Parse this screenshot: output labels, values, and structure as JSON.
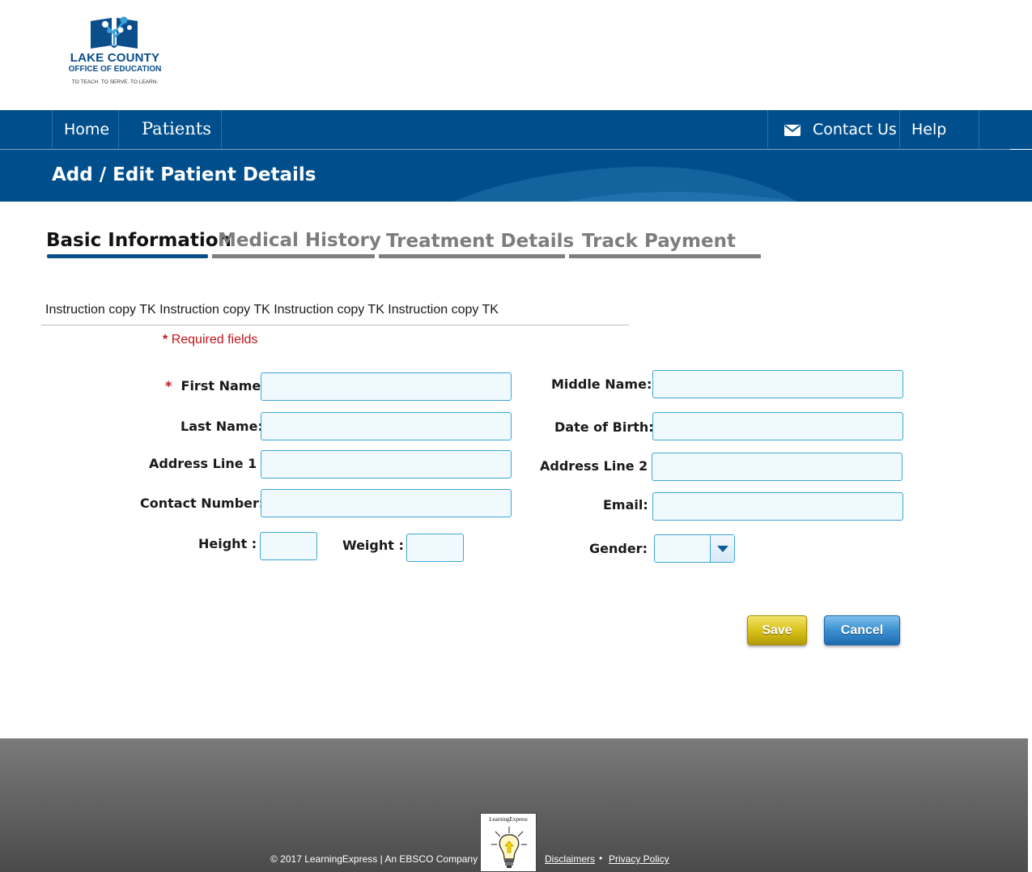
{
  "logo": {
    "line1": "LAKE COUNTY",
    "line2": "OFFICE OF EDUCATION",
    "tagline": "TO TEACH. TO SERVE. TO LEARN."
  },
  "nav": {
    "home": "Home",
    "patients": "Patients",
    "contact": "Contact Us",
    "help": "Help"
  },
  "page_title": "Add / Edit Patient Details",
  "tabs": [
    {
      "label": "Basic Information",
      "active": true
    },
    {
      "label": "Medical History",
      "active": false
    },
    {
      "label": "Treatment Details",
      "active": false
    },
    {
      "label": "Track Payment",
      "active": false
    }
  ],
  "instruction": "Instruction copy TK Instruction copy TK Instruction copy TK Instruction copy TK",
  "required_note": {
    "star": "*",
    "text": "Required fields"
  },
  "form": {
    "first_name": {
      "label": "First Name",
      "required_star": "*",
      "value": ""
    },
    "middle_name": {
      "label": "Middle Name",
      "value": ""
    },
    "last_name": {
      "label": "Last Name",
      "value": ""
    },
    "date_of_birth": {
      "label": "Date of Birth",
      "value": ""
    },
    "address_line_1": {
      "label": "Address Line 1",
      "value": ""
    },
    "address_line_2": {
      "label": "Address Line 2",
      "value": ""
    },
    "contact_number": {
      "label": "Contact Number",
      "value": ""
    },
    "email": {
      "label": "Email",
      "value": ""
    },
    "height": {
      "label": "Height",
      "value": ""
    },
    "weight": {
      "label": "Weight",
      "value": ""
    },
    "gender": {
      "label": "Gender",
      "value": ""
    }
  },
  "buttons": {
    "save": "Save",
    "cancel": "Cancel"
  },
  "footer": {
    "copyright": "© 2017 LearningExpress  |  An EBSCO Company",
    "brand": "LearningExpress",
    "disclaimers": "Disclaimers",
    "separator": "•",
    "privacy": "Privacy Policy"
  },
  "colors": {
    "nav_blue": "#004f8c",
    "field_border": "#3ea7d6",
    "required_red": "#c0151b",
    "save_gold": "#d9c21a",
    "cancel_blue": "#3b8fd0"
  },
  "icons": {
    "contact": "envelope-icon",
    "gender_dropdown": "chevron-down-icon",
    "logo": "book-tree-icon",
    "footer_logo": "lightbulb-icon"
  }
}
